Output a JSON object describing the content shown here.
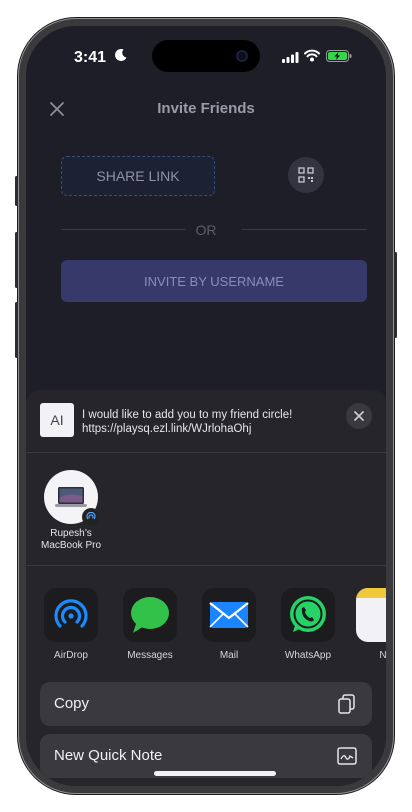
{
  "status_bar": {
    "time": "3:41"
  },
  "header": {
    "title": "Invite Friends"
  },
  "actions": {
    "share_link": "SHARE LINK",
    "or_text": "OR",
    "invite_by_username": "INVITE BY USERNAME"
  },
  "share_sheet": {
    "doc_icon_text": "AI",
    "message_line1": "I would like to add you to my friend circle!",
    "message_line2": "https://playsq.ezl.link/WJrlohaOhj",
    "airdrop_device": {
      "name_line1": "Rupesh’s",
      "name_line2": "MacBook Pro"
    },
    "apps": [
      {
        "label": "AirDrop",
        "icon": "airdrop-icon",
        "color": "#1a8cff"
      },
      {
        "label": "Messages",
        "icon": "messages-icon",
        "color": "#32c24a"
      },
      {
        "label": "Mail",
        "icon": "mail-icon",
        "color": "#1a85ff"
      },
      {
        "label": "WhatsApp",
        "icon": "whatsapp-icon",
        "color": "#25d366"
      },
      {
        "label": "N",
        "icon": "notes-icon",
        "color": "#f2f2f6"
      }
    ],
    "action_items": [
      {
        "label": "Copy",
        "icon": "copy-icon"
      },
      {
        "label": "New Quick Note",
        "icon": "quick-note-icon"
      }
    ]
  }
}
